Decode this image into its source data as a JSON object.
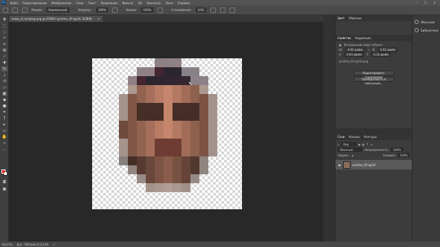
{
  "menu": [
    "Файл",
    "Редактирование",
    "Изображение",
    "Слои",
    "Текст",
    "Выделение",
    "Фильтр",
    "3D",
    "Просмотр",
    "Окно",
    "Справка"
  ],
  "options": {
    "mode_label": "Режим:",
    "mode_value": "Нормальный",
    "opacity_label": "Непрозр.:",
    "opacity_value": "100%",
    "flow_label": "Нажим:",
    "flow_value": "100%",
    "smoothing_label": "Сглаживание:",
    "smoothing_value": "10%"
  },
  "document_tab": {
    "title": "lenka_id_endylog.png @ 4768% (pristine_SFn@16, RGB/8)",
    "close": "×"
  },
  "status": {
    "zoom": "66,67%",
    "doc_info": "Док: 768 байт/1,43 КБ",
    "arrow": ">"
  },
  "properties_panel": {
    "tabs": [
      "Цвет",
      "Образцы"
    ],
    "subtabs": [
      "Свойства",
      "Коррекция"
    ],
    "smart_object_label": "Встроенный смарт-объект",
    "w_label": "Ш:",
    "w_value": "0,92 дюйм",
    "h_label": "В:",
    "h_value": "0,92 дюйм",
    "x_label": "X:",
    "x_value": "0,93 дюйм",
    "y_label": "Y:",
    "y_value": "0,10 дюйм",
    "file_name": "pristine_SFn@16.png",
    "btn_edit": "Редактировать содержимое",
    "btn_convert": "Преобразовать в связанный..."
  },
  "layers_panel": {
    "tabs": [
      "Слои",
      "Каналы",
      "Контуры"
    ],
    "kind_label": "Вид",
    "blend_mode": "Обычные",
    "opacity_label": "Непрозрачность:",
    "opacity_value": "100%",
    "lock_label": "Закреп.:",
    "fill_label": "Заливка:",
    "fill_value": "100%",
    "layer_name": "pristine_SFn@16"
  },
  "right_sidebar": {
    "learn_label": "Обучение",
    "libraries_label": "Библиотеки"
  },
  "colors": {
    "foreground": "#e02020",
    "background": "#ffffff",
    "accent": "#31a8ff"
  }
}
